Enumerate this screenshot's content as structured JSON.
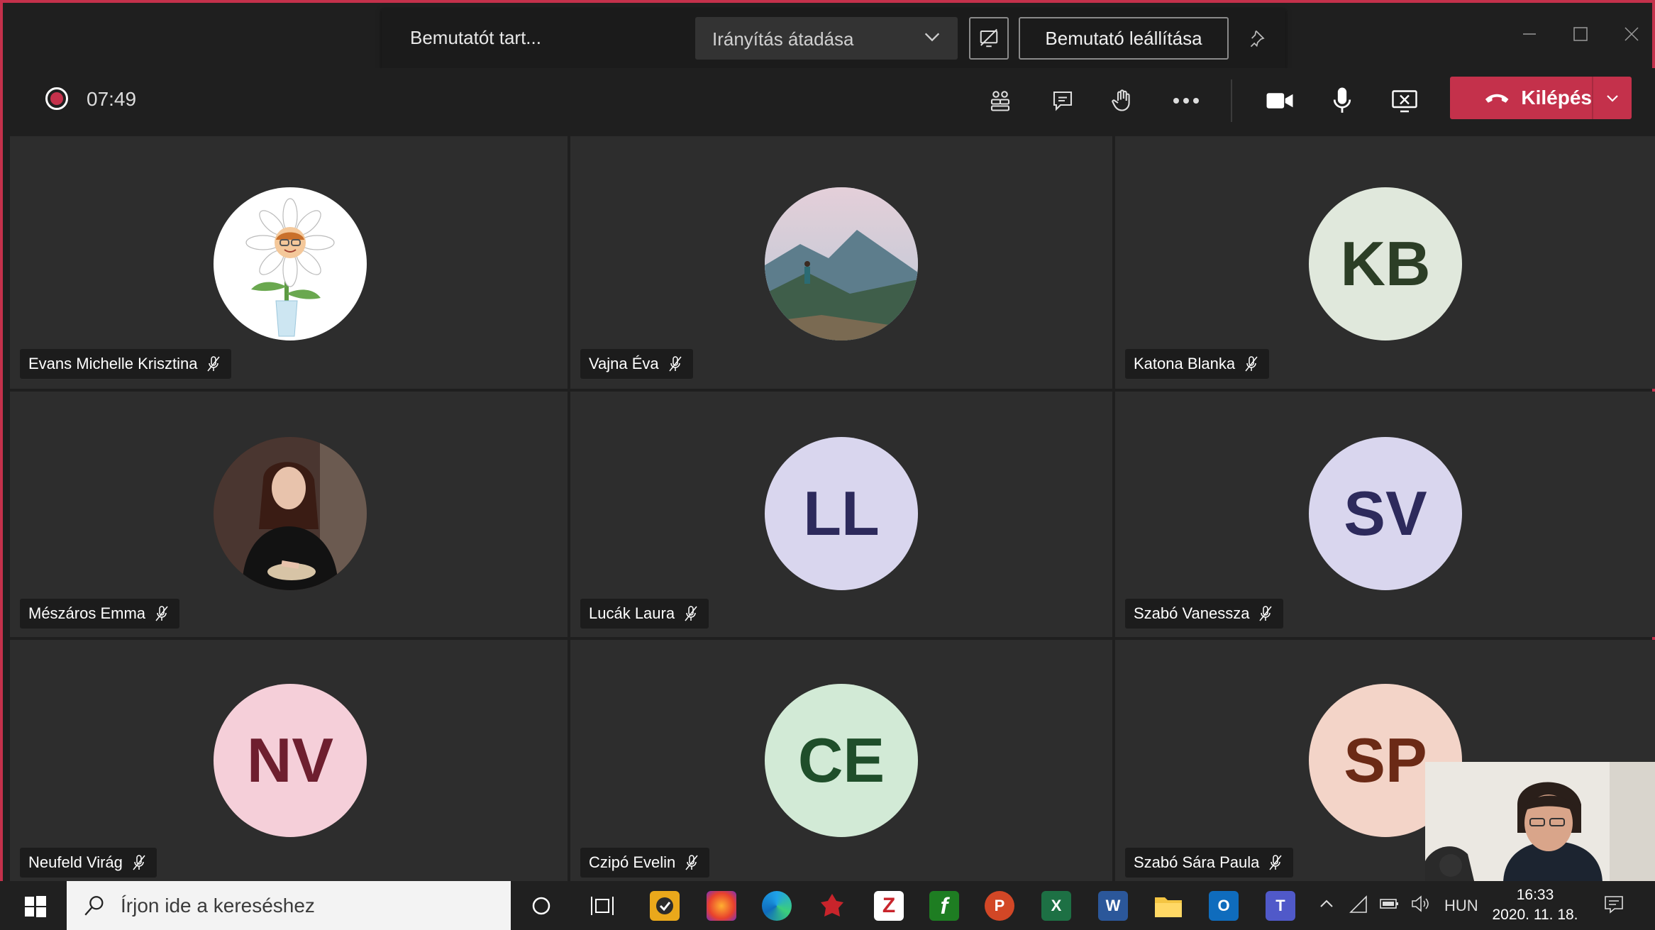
{
  "share_bar": {
    "presenting_label": "Bemutatót tart...",
    "give_control_label": "Irányítás átadása",
    "stop_presenting_label": "Bemutató leállítása"
  },
  "toolbar": {
    "timer": "07:49",
    "leave_label": "Kilépés"
  },
  "participants": [
    {
      "name": "Evans Michelle Krisztina",
      "initials": "",
      "muted": true
    },
    {
      "name": "Vajna Éva",
      "initials": "",
      "muted": true
    },
    {
      "name": "Katona Blanka",
      "initials": "KB",
      "muted": true
    },
    {
      "name": "Mészáros Emma",
      "initials": "",
      "muted": true
    },
    {
      "name": "Lucák Laura",
      "initials": "LL",
      "muted": true
    },
    {
      "name": "Szabó Vanessza",
      "initials": "SV",
      "muted": true
    },
    {
      "name": "Neufeld Virág",
      "initials": "NV",
      "muted": true
    },
    {
      "name": "Czipó Evelin",
      "initials": "CE",
      "muted": true
    },
    {
      "name": "Szabó Sára Paula",
      "initials": "SP",
      "muted": true
    }
  ],
  "colors": {
    "accent_red": "#c4314b",
    "kb_bg": "#e0e8dc",
    "kb_fg": "#2c3e26",
    "ll_bg": "#d9d6ee",
    "ll_fg": "#2d2a5c",
    "sv_bg": "#d9d6ee",
    "sv_fg": "#2d2a5c",
    "nv_bg": "#f5cfd9",
    "nv_fg": "#6e1f2f",
    "ce_bg": "#d2ead6",
    "ce_fg": "#1f4e2a",
    "sp_bg": "#f3d4c8",
    "sp_fg": "#6b2a16"
  },
  "taskbar": {
    "search_placeholder": "Írjon ide a kereséshez",
    "language": "HUN",
    "time": "16:33",
    "date": "2020. 11. 18."
  }
}
